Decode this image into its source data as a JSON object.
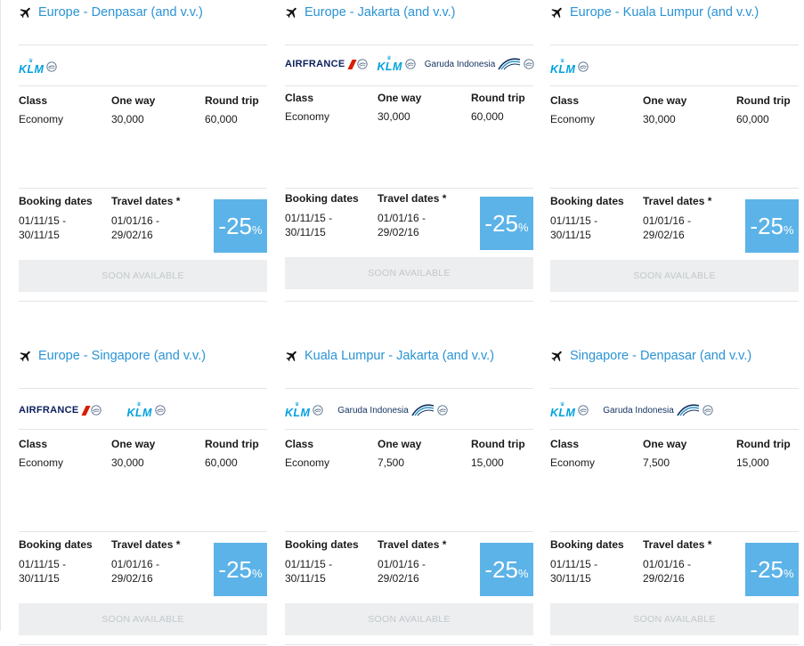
{
  "labels": {
    "class": "Class",
    "one_way": "One way",
    "round_trip": "Round trip",
    "booking_dates": "Booking dates",
    "travel_dates": "Travel dates *",
    "discount_value": "-25",
    "discount_pct": "%",
    "soon_available": "SOON AVAILABLE"
  },
  "brand": {
    "airfrance": "AIRFRANCE",
    "klm": "KLM",
    "klm_crown": "♛",
    "garuda": "Garuda Indonesia"
  },
  "colors": {
    "accent": "#2a93d5",
    "discount_bg": "#5cb3e8",
    "button_bg": "#eceeef"
  },
  "cards": [
    {
      "route": "Europe - Denpasar (and v.v.)",
      "logos": [
        "klm"
      ],
      "class_value": "Economy",
      "one_way_value": "30,000",
      "round_trip_value": "60,000",
      "booking_from": "01/11/15 -",
      "booking_to": "30/11/15",
      "travel_from": "01/01/16 -",
      "travel_to": "29/02/16"
    },
    {
      "route": "Europe - Jakarta (and v.v.)",
      "logos": [
        "airfrance",
        "klm",
        "garuda"
      ],
      "class_value": "Economy",
      "one_way_value": "30,000",
      "round_trip_value": "60,000",
      "booking_from": "01/11/15 -",
      "booking_to": "30/11/15",
      "travel_from": "01/01/16 -",
      "travel_to": "29/02/16"
    },
    {
      "route": "Europe - Kuala Lumpur (and v.v.)",
      "logos": [
        "klm"
      ],
      "class_value": "Economy",
      "one_way_value": "30,000",
      "round_trip_value": "60,000",
      "booking_from": "01/11/15 -",
      "booking_to": "30/11/15",
      "travel_from": "01/01/16 -",
      "travel_to": "29/02/16"
    },
    {
      "route": "Europe - Singapore (and v.v.)",
      "logos": [
        "airfrance",
        "klm"
      ],
      "class_value": "Economy",
      "one_way_value": "30,000",
      "round_trip_value": "60,000",
      "booking_from": "01/11/15 -",
      "booking_to": "30/11/15",
      "travel_from": "01/01/16 -",
      "travel_to": "29/02/16"
    },
    {
      "route": "Kuala Lumpur - Jakarta (and v.v.)",
      "logos": [
        "klm",
        "garuda"
      ],
      "class_value": "Economy",
      "one_way_value": "7,500",
      "round_trip_value": "15,000",
      "booking_from": "01/11/15 -",
      "booking_to": "30/11/15",
      "travel_from": "01/01/16 -",
      "travel_to": "29/02/16"
    },
    {
      "route": "Singapore - Denpasar (and v.v.)",
      "logos": [
        "klm",
        "garuda"
      ],
      "class_value": "Economy",
      "one_way_value": "7,500",
      "round_trip_value": "15,000",
      "booking_from": "01/11/15 -",
      "booking_to": "30/11/15",
      "travel_from": "01/01/16 -",
      "travel_to": "29/02/16"
    }
  ]
}
